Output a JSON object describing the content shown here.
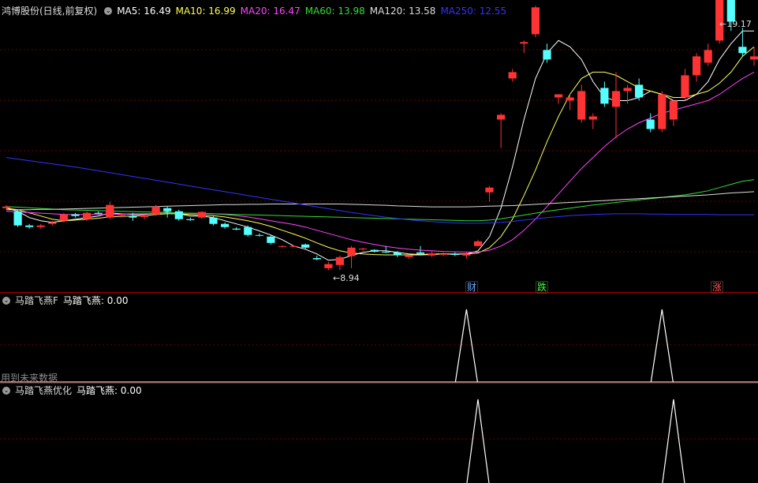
{
  "main": {
    "title": "鸿博股份(日线,前复权)",
    "ma_labels": [
      {
        "key": "ma5",
        "text": "MA5: 16.49",
        "color": "#ffffff"
      },
      {
        "key": "ma10",
        "text": "MA10: 16.99",
        "color": "#ffff55"
      },
      {
        "key": "ma20",
        "text": "MA20: 16.47",
        "color": "#ff44ff"
      },
      {
        "key": "ma60",
        "text": "MA60: 13.98",
        "color": "#33dd33"
      },
      {
        "key": "ma120",
        "text": "MA120: 13.58",
        "color": "#dddddd"
      },
      {
        "key": "ma250",
        "text": "MA250: 12.55",
        "color": "#3333ff"
      }
    ],
    "high_label": "19.17",
    "low_label": "8.94",
    "events": [
      {
        "text": "财",
        "color": "#66aaff"
      },
      {
        "text": "跌",
        "color": "#44ff44"
      },
      {
        "text": "涨",
        "color": "#ff5555"
      }
    ]
  },
  "sub1": {
    "title": "马踏飞燕F",
    "value_label": "马踏飞燕: 0.00",
    "note": "用到未来数据"
  },
  "sub2": {
    "title": "马踏飞燕优化",
    "value_label": "马踏飞燕: 0.00"
  },
  "colors": {
    "up": "#ff3333",
    "down": "#55ffff",
    "grid": "#6a0000",
    "divider": "#b00000"
  },
  "chart_data": {
    "type": "candlestick",
    "ohlc": [
      [
        10.9,
        11.0,
        10.85,
        10.95
      ],
      [
        10.8,
        10.85,
        10.3,
        10.35
      ],
      [
        10.35,
        10.4,
        10.25,
        10.3
      ],
      [
        10.3,
        10.4,
        10.25,
        10.35
      ],
      [
        10.4,
        10.5,
        10.35,
        10.45
      ],
      [
        10.5,
        10.75,
        10.45,
        10.7
      ],
      [
        10.7,
        10.75,
        10.6,
        10.65
      ],
      [
        10.55,
        10.8,
        10.5,
        10.75
      ],
      [
        10.75,
        10.8,
        10.7,
        10.72
      ],
      [
        10.6,
        11.1,
        10.55,
        11.0
      ],
      [
        10.7,
        10.75,
        10.6,
        10.7
      ],
      [
        10.65,
        10.75,
        10.5,
        10.6
      ],
      [
        10.62,
        10.7,
        10.55,
        10.68
      ],
      [
        10.7,
        11.0,
        10.65,
        10.95
      ],
      [
        10.9,
        10.95,
        10.6,
        10.8
      ],
      [
        10.8,
        10.85,
        10.5,
        10.55
      ],
      [
        10.55,
        10.6,
        10.5,
        10.52
      ],
      [
        10.6,
        10.8,
        10.55,
        10.78
      ],
      [
        10.6,
        10.65,
        10.35,
        10.4
      ],
      [
        10.4,
        10.45,
        10.25,
        10.3
      ],
      [
        10.25,
        10.3,
        10.2,
        10.22
      ],
      [
        10.3,
        10.35,
        10.0,
        10.05
      ],
      [
        10.05,
        10.1,
        10.0,
        10.03
      ],
      [
        10.0,
        10.05,
        9.75,
        9.8
      ],
      [
        9.68,
        9.72,
        9.66,
        9.7
      ],
      [
        9.7,
        9.72,
        9.68,
        9.7
      ],
      [
        9.75,
        9.78,
        9.6,
        9.65
      ],
      [
        9.32,
        9.4,
        9.25,
        9.28
      ],
      [
        9.0,
        9.2,
        8.94,
        9.13
      ],
      [
        9.1,
        9.4,
        8.94,
        9.35
      ],
      [
        9.38,
        9.7,
        9.0,
        9.65
      ],
      [
        9.6,
        9.65,
        9.55,
        9.62
      ],
      [
        9.58,
        9.6,
        9.5,
        9.52
      ],
      [
        9.52,
        9.7,
        9.48,
        9.5
      ],
      [
        9.5,
        9.55,
        9.35,
        9.42
      ],
      [
        9.35,
        9.42,
        9.3,
        9.4
      ],
      [
        9.5,
        9.7,
        9.4,
        9.45
      ],
      [
        9.4,
        9.55,
        9.35,
        9.47
      ],
      [
        9.45,
        9.5,
        9.38,
        9.45
      ],
      [
        9.45,
        9.5,
        9.38,
        9.42
      ],
      [
        9.4,
        9.5,
        9.3,
        9.45
      ],
      [
        9.7,
        9.9,
        9.7,
        9.85
      ],
      [
        11.4,
        11.6,
        11.1,
        11.55
      ],
      [
        13.7,
        13.9,
        12.8,
        13.85
      ],
      [
        15.0,
        15.3,
        14.9,
        15.2
      ],
      [
        16.1,
        16.2,
        15.8,
        16.15
      ],
      [
        16.4,
        17.3,
        16.3,
        17.25
      ],
      [
        15.9,
        16.1,
        15.5,
        15.6
      ],
      [
        14.4,
        14.5,
        14.2,
        14.5
      ],
      [
        14.3,
        14.5,
        14.0,
        14.4
      ],
      [
        13.7,
        14.8,
        13.6,
        14.6
      ],
      [
        13.7,
        13.9,
        13.4,
        13.8
      ],
      [
        14.7,
        14.9,
        14.1,
        14.2
      ],
      [
        14.1,
        15.2,
        13.1,
        14.6
      ],
      [
        14.6,
        14.8,
        14.2,
        14.7
      ],
      [
        14.8,
        15.0,
        14.3,
        14.4
      ],
      [
        13.7,
        13.9,
        13.3,
        13.4
      ],
      [
        13.4,
        14.6,
        13.3,
        14.5
      ],
      [
        13.7,
        14.3,
        13.5,
        14.3
      ],
      [
        14.4,
        15.3,
        14.3,
        15.1
      ],
      [
        15.1,
        15.8,
        14.9,
        15.7
      ],
      [
        15.5,
        16.1,
        15.4,
        15.9
      ],
      [
        16.2,
        19.17,
        16.1,
        18.5
      ],
      [
        19.17,
        19.3,
        16.5,
        16.8
      ],
      [
        16.0,
        16.6,
        15.7,
        15.8
      ],
      [
        15.6,
        16.0,
        15.4,
        15.7
      ]
    ],
    "ma": {
      "ma5": [
        10.9,
        10.8,
        10.6,
        10.5,
        10.45,
        10.5,
        10.55,
        10.6,
        10.65,
        10.75,
        10.72,
        10.7,
        10.7,
        10.75,
        10.78,
        10.72,
        10.65,
        10.65,
        10.6,
        10.5,
        10.4,
        10.3,
        10.18,
        10.05,
        9.9,
        9.7,
        9.6,
        9.45,
        9.25,
        9.28,
        9.4,
        9.5,
        9.55,
        9.55,
        9.5,
        9.45,
        9.43,
        9.45,
        9.45,
        9.44,
        9.45,
        9.55,
        10.0,
        10.9,
        12.2,
        13.7,
        15.0,
        15.8,
        16.2,
        16.0,
        15.6,
        14.9,
        14.4,
        14.3,
        14.3,
        14.4,
        14.6,
        14.5,
        14.3,
        14.3,
        14.5,
        14.9,
        15.6,
        16.1,
        16.5,
        16.5
      ],
      "ma10": [
        10.9,
        10.85,
        10.75,
        10.65,
        10.55,
        10.5,
        10.52,
        10.55,
        10.58,
        10.62,
        10.64,
        10.65,
        10.66,
        10.7,
        10.72,
        10.72,
        10.7,
        10.68,
        10.66,
        10.62,
        10.56,
        10.5,
        10.42,
        10.32,
        10.2,
        10.08,
        9.95,
        9.8,
        9.66,
        9.55,
        9.48,
        9.45,
        9.43,
        9.42,
        9.42,
        9.42,
        9.42,
        9.43,
        9.45,
        9.45,
        9.45,
        9.48,
        9.65,
        10.0,
        10.55,
        11.3,
        12.1,
        13.0,
        13.8,
        14.5,
        15.0,
        15.2,
        15.2,
        15.1,
        14.9,
        14.7,
        14.6,
        14.5,
        14.4,
        14.4,
        14.5,
        14.6,
        14.85,
        15.2,
        15.7,
        16.0
      ],
      "ma20": [
        10.8,
        10.78,
        10.76,
        10.74,
        10.72,
        10.7,
        10.7,
        10.7,
        10.7,
        10.7,
        10.71,
        10.72,
        10.72,
        10.73,
        10.74,
        10.74,
        10.74,
        10.73,
        10.72,
        10.7,
        10.66,
        10.62,
        10.56,
        10.5,
        10.44,
        10.38,
        10.3,
        10.2,
        10.1,
        10.0,
        9.9,
        9.82,
        9.75,
        9.69,
        9.64,
        9.6,
        9.57,
        9.55,
        9.53,
        9.52,
        9.51,
        9.51,
        9.57,
        9.7,
        9.9,
        10.2,
        10.55,
        10.95,
        11.35,
        11.75,
        12.15,
        12.5,
        12.85,
        13.15,
        13.4,
        13.6,
        13.75,
        13.9,
        14.0,
        14.1,
        14.2,
        14.3,
        14.5,
        14.75,
        15.0,
        15.2
      ],
      "ma60": [
        10.95,
        10.93,
        10.91,
        10.89,
        10.87,
        10.85,
        10.84,
        10.83,
        10.82,
        10.81,
        10.8,
        10.79,
        10.78,
        10.77,
        10.76,
        10.75,
        10.74,
        10.73,
        10.72,
        10.71,
        10.7,
        10.69,
        10.68,
        10.67,
        10.66,
        10.65,
        10.64,
        10.63,
        10.62,
        10.61,
        10.6,
        10.59,
        10.58,
        10.57,
        10.56,
        10.55,
        10.54,
        10.53,
        10.52,
        10.51,
        10.5,
        10.5,
        10.52,
        10.56,
        10.62,
        10.68,
        10.74,
        10.8,
        10.85,
        10.9,
        10.95,
        11.0,
        11.04,
        11.08,
        11.12,
        11.16,
        11.2,
        11.24,
        11.28,
        11.32,
        11.38,
        11.45,
        11.55,
        11.65,
        11.75,
        11.8
      ],
      "ma120": [
        10.85,
        10.85,
        10.85,
        10.86,
        10.86,
        10.87,
        10.88,
        10.89,
        10.9,
        10.91,
        10.92,
        10.93,
        10.94,
        10.95,
        10.96,
        10.97,
        10.98,
        10.99,
        11.0,
        11.01,
        11.01,
        11.02,
        11.02,
        11.03,
        11.03,
        11.03,
        11.03,
        11.03,
        11.03,
        11.03,
        11.02,
        11.01,
        11.0,
        10.99,
        10.97,
        10.96,
        10.95,
        10.94,
        10.94,
        10.94,
        10.94,
        10.95,
        10.96,
        10.97,
        10.98,
        11.0,
        11.02,
        11.04,
        11.06,
        11.08,
        11.1,
        11.12,
        11.14,
        11.16,
        11.18,
        11.2,
        11.22,
        11.24,
        11.26,
        11.28,
        11.3,
        11.32,
        11.35,
        11.38,
        11.4,
        11.42
      ],
      "ma250": [
        12.5,
        12.45,
        12.4,
        12.35,
        12.3,
        12.25,
        12.2,
        12.14,
        12.08,
        12.02,
        11.96,
        11.9,
        11.84,
        11.78,
        11.72,
        11.66,
        11.6,
        11.54,
        11.48,
        11.42,
        11.36,
        11.3,
        11.24,
        11.18,
        11.12,
        11.06,
        11.0,
        10.94,
        10.88,
        10.82,
        10.76,
        10.71,
        10.66,
        10.61,
        10.57,
        10.53,
        10.5,
        10.47,
        10.45,
        10.43,
        10.42,
        10.42,
        10.43,
        10.45,
        10.48,
        10.52,
        10.56,
        10.6,
        10.63,
        10.66,
        10.68,
        10.7,
        10.71,
        10.72,
        10.72,
        10.72,
        10.71,
        10.71,
        10.7,
        10.7,
        10.7,
        10.7,
        10.69,
        10.69,
        10.69,
        10.69
      ]
    },
    "signal_f": {
      "peaks": [
        40,
        57
      ],
      "value": "0.00"
    },
    "signal_opt": {
      "peaks": [
        41,
        58
      ],
      "value": "0.00"
    }
  }
}
